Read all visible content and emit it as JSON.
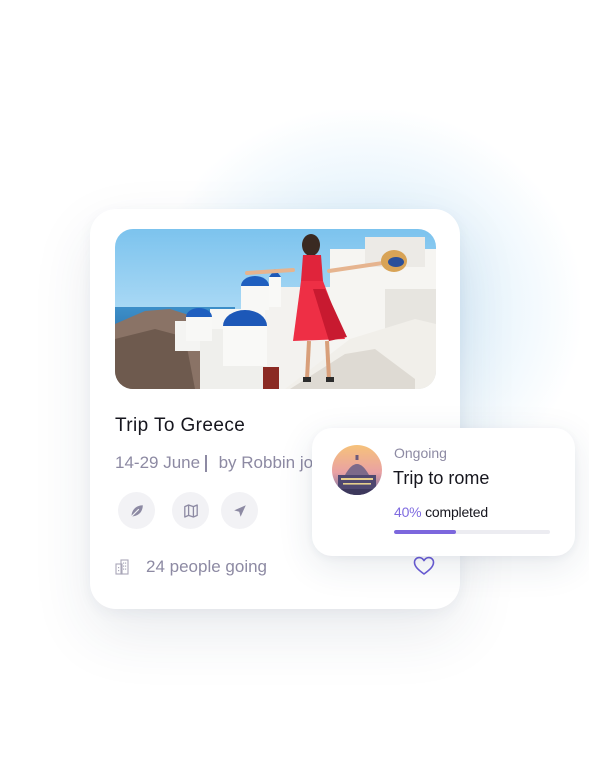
{
  "trip_card": {
    "image_alt": "Woman in red dress in Santorini",
    "title": "Trip To Greece",
    "dates": "14-29 June",
    "organizer": "by Robbin jo",
    "actions": [
      "leaf-icon",
      "map-icon",
      "send-icon"
    ],
    "people_going": "24 people going",
    "favorite_icon": "heart-icon"
  },
  "rome_card": {
    "status": "Ongoing",
    "title": "Trip to rome",
    "progress_percent_label": "40%",
    "progress_suffix": " completed",
    "progress_value": 0.4
  },
  "colors": {
    "accent": "#7c67dd",
    "muted_text": "#8d8aa3",
    "heading_text": "#16161e",
    "heart": "#6a5bd6",
    "button_bg": "#f2f2f5"
  }
}
